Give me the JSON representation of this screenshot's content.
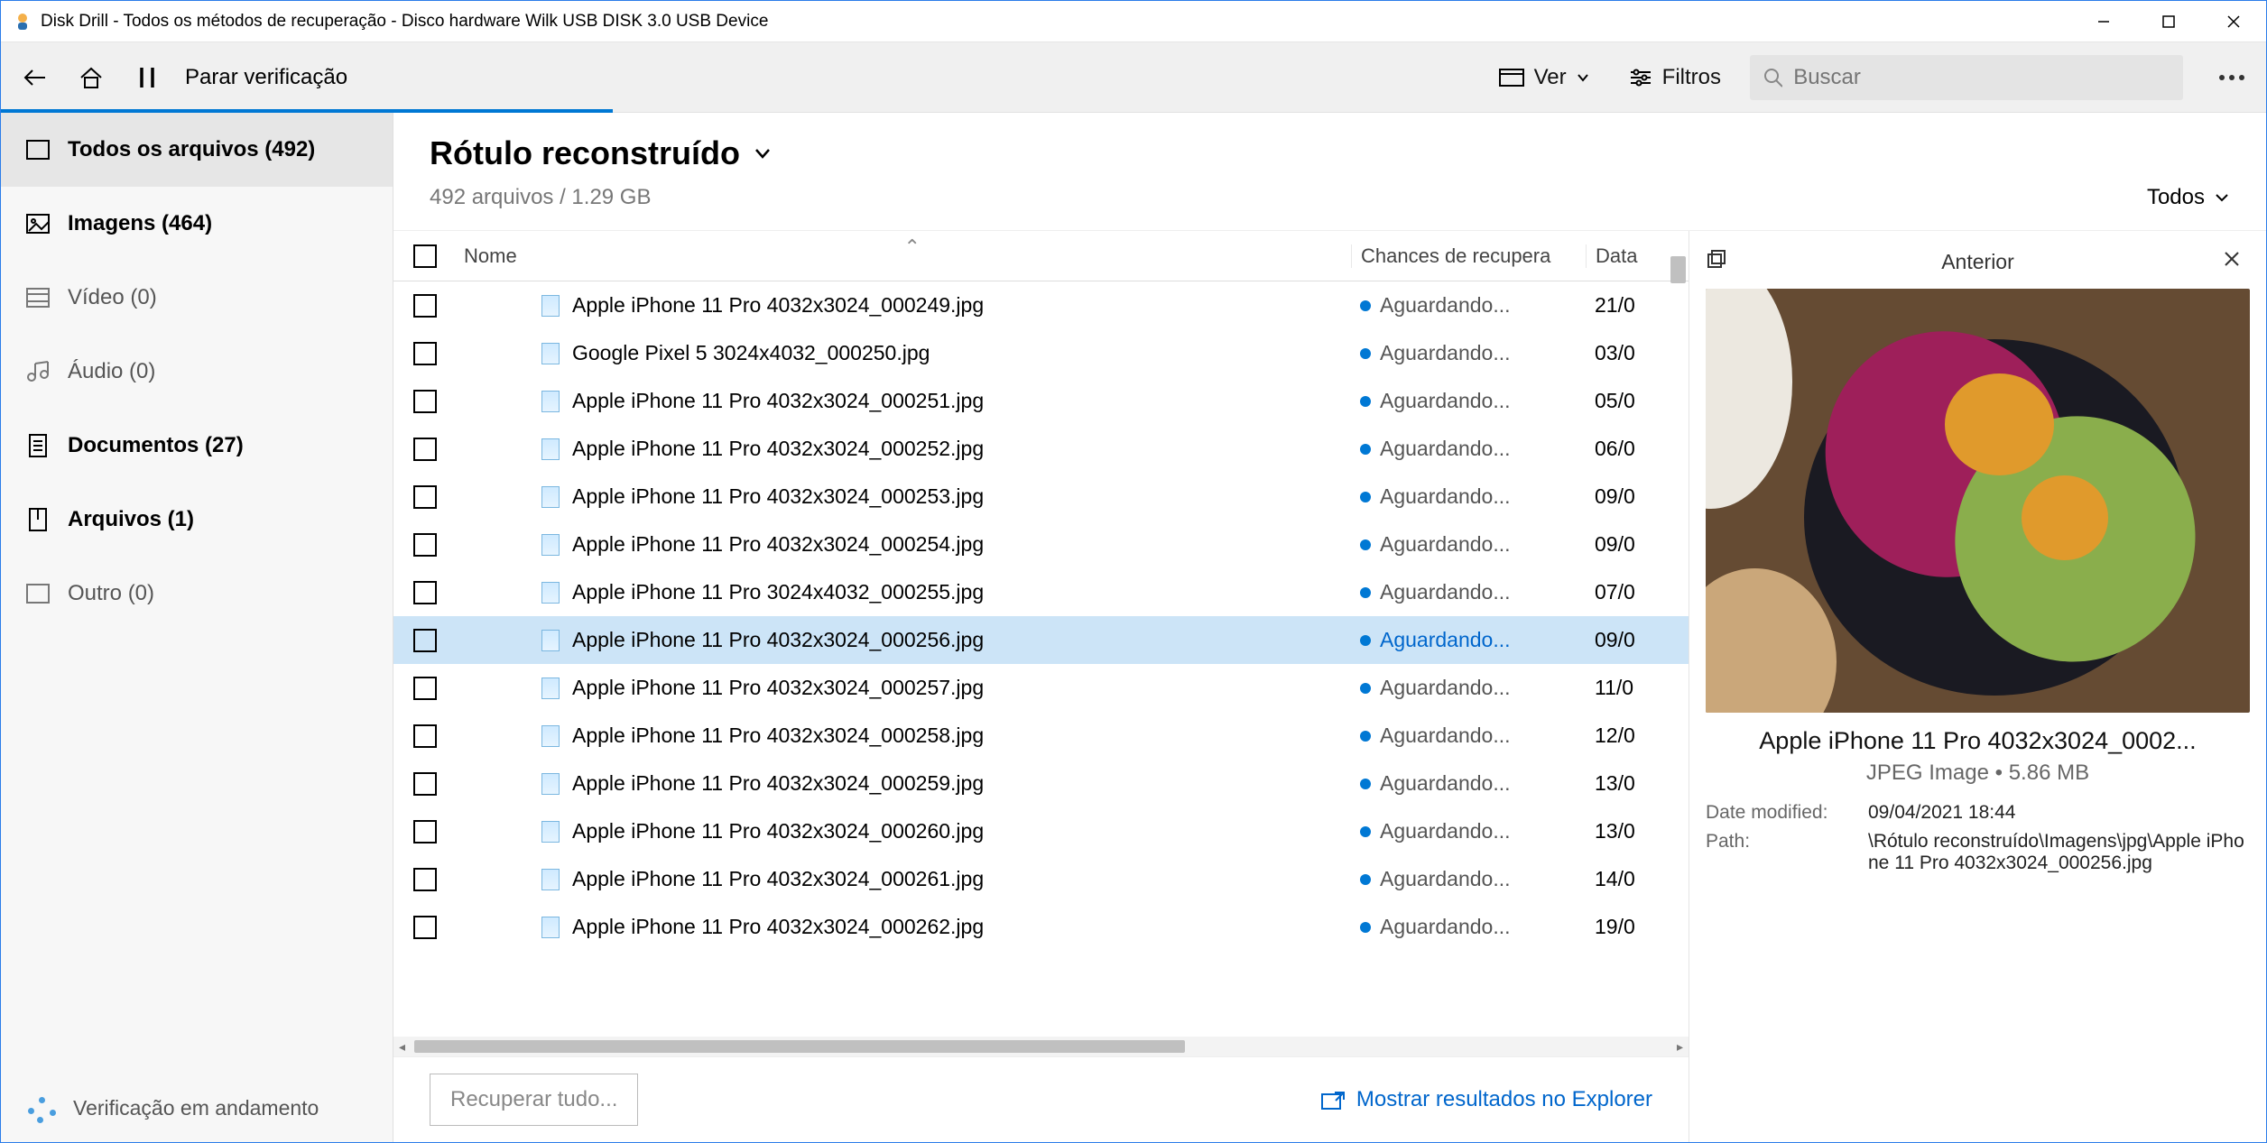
{
  "window": {
    "title": "Disk Drill - Todos os métodos de recuperação - Disco hardware Wilk USB DISK 3.0 USB Device"
  },
  "toolbar": {
    "stop_scan": "Parar verificação",
    "view": "Ver",
    "filters": "Filtros",
    "search_placeholder": "Buscar"
  },
  "sidebar": {
    "items": [
      {
        "label": "Todos os arquivos (492)"
      },
      {
        "label": "Imagens (464)"
      },
      {
        "label": "Vídeo (0)"
      },
      {
        "label": "Áudio (0)"
      },
      {
        "label": "Documentos (27)"
      },
      {
        "label": "Arquivos (1)"
      },
      {
        "label": "Outro (0)"
      }
    ],
    "status": "Verificação em andamento"
  },
  "content": {
    "heading": "Rótulo reconstruído",
    "sub": "492 arquivos / 1.29 GB",
    "filter_label": "Todos",
    "columns": {
      "name": "Nome",
      "chance": "Chances de recupera",
      "date": "Data"
    },
    "recover_btn": "Recuperar tudo...",
    "show_explorer": "Mostrar resultados no Explorer"
  },
  "rows": [
    {
      "name": "Apple iPhone 11 Pro 4032x3024_000249.jpg",
      "chance": "Aguardando...",
      "date": "21/0"
    },
    {
      "name": "Google Pixel 5 3024x4032_000250.jpg",
      "chance": "Aguardando...",
      "date": "03/0"
    },
    {
      "name": "Apple iPhone 11 Pro 4032x3024_000251.jpg",
      "chance": "Aguardando...",
      "date": "05/0"
    },
    {
      "name": "Apple iPhone 11 Pro 4032x3024_000252.jpg",
      "chance": "Aguardando...",
      "date": "06/0"
    },
    {
      "name": "Apple iPhone 11 Pro 4032x3024_000253.jpg",
      "chance": "Aguardando...",
      "date": "09/0"
    },
    {
      "name": "Apple iPhone 11 Pro 4032x3024_000254.jpg",
      "chance": "Aguardando...",
      "date": "09/0"
    },
    {
      "name": "Apple iPhone 11 Pro 3024x4032_000255.jpg",
      "chance": "Aguardando...",
      "date": "07/0"
    },
    {
      "name": "Apple iPhone 11 Pro 4032x3024_000256.jpg",
      "chance": "Aguardando...",
      "date": "09/0",
      "selected": true
    },
    {
      "name": "Apple iPhone 11 Pro 4032x3024_000257.jpg",
      "chance": "Aguardando...",
      "date": "11/0"
    },
    {
      "name": "Apple iPhone 11 Pro 4032x3024_000258.jpg",
      "chance": "Aguardando...",
      "date": "12/0"
    },
    {
      "name": "Apple iPhone 11 Pro 4032x3024_000259.jpg",
      "chance": "Aguardando...",
      "date": "13/0"
    },
    {
      "name": "Apple iPhone 11 Pro 4032x3024_000260.jpg",
      "chance": "Aguardando...",
      "date": "13/0"
    },
    {
      "name": "Apple iPhone 11 Pro 4032x3024_000261.jpg",
      "chance": "Aguardando...",
      "date": "14/0"
    },
    {
      "name": "Apple iPhone 11 Pro 4032x3024_000262.jpg",
      "chance": "Aguardando...",
      "date": "19/0"
    }
  ],
  "preview": {
    "header": "Anterior",
    "name": "Apple iPhone 11 Pro 4032x3024_0002...",
    "meta": "JPEG Image • 5.86 MB",
    "date_label": "Date modified:",
    "date_value": "09/04/2021 18:44",
    "path_label": "Path:",
    "path_value": "\\Rótulo reconstruído\\Imagens\\jpg\\Apple iPhone 11 Pro 4032x3024_000256.jpg"
  }
}
